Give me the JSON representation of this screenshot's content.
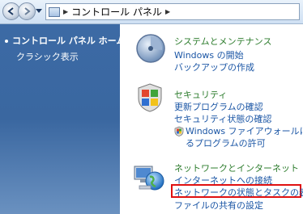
{
  "address_bar": {
    "path": "コントロール パネル"
  },
  "sidebar": {
    "items": [
      {
        "label": "コントロール パネル ホーム"
      },
      {
        "label": "クラシック表示"
      }
    ]
  },
  "categories": [
    {
      "title": "システムとメンテナンス",
      "icon": "system-maintenance-icon",
      "links": [
        "Windows の開始",
        "バックアップの作成"
      ]
    },
    {
      "title": "セキュリティ",
      "icon": "security-shield-icon",
      "links": [
        "更新プログラムの確認",
        "セキュリティ状態の確認",
        "Windows ファイアウォールによ",
        "るプログラムの許可"
      ]
    },
    {
      "title": "ネットワークとインターネット",
      "icon": "network-globe-icon",
      "links": [
        "インターネットへの接続",
        "ネットワークの状態とタスクの表示",
        "ファイルの共有の設定"
      ]
    }
  ],
  "colors": {
    "sidebar": "#3a67a0",
    "category_title": "#2e7d2e",
    "link": "#1b56a5",
    "highlight": "#e01010"
  }
}
